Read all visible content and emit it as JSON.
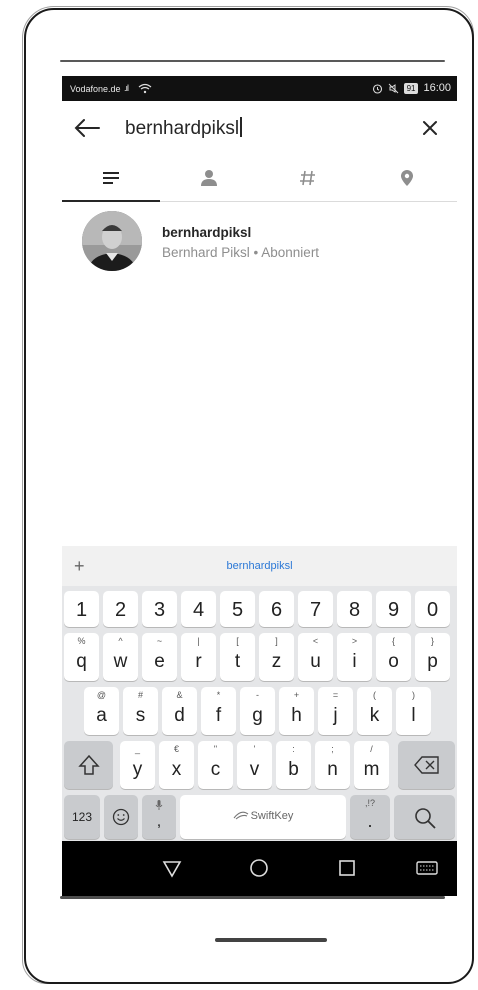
{
  "status_bar": {
    "carrier": "Vodafone.de",
    "signal": ".ıl",
    "battery": "91",
    "time": "16:00"
  },
  "search": {
    "query": "bernhardpiksl"
  },
  "tabs": [
    {
      "name": "top",
      "icon": "lines-icon",
      "active": true
    },
    {
      "name": "people",
      "icon": "person-icon",
      "active": false
    },
    {
      "name": "tags",
      "icon": "hashtag-icon",
      "active": false
    },
    {
      "name": "places",
      "icon": "location-pin-icon",
      "active": false
    }
  ],
  "result": {
    "username": "bernhardpiksl",
    "subtitle": "Bernhard Piksl • Abonniert"
  },
  "keyboard": {
    "suggestion_plus": "+",
    "suggestion": "bernhardpiksl",
    "numbers": [
      "1",
      "2",
      "3",
      "4",
      "5",
      "6",
      "7",
      "8",
      "9",
      "0"
    ],
    "row1": [
      {
        "main": "q",
        "sub": "%"
      },
      {
        "main": "w",
        "sub": "^"
      },
      {
        "main": "e",
        "sub": "~"
      },
      {
        "main": "r",
        "sub": "|"
      },
      {
        "main": "t",
        "sub": "["
      },
      {
        "main": "z",
        "sub": "]"
      },
      {
        "main": "u",
        "sub": "<"
      },
      {
        "main": "i",
        "sub": ">"
      },
      {
        "main": "o",
        "sub": "{"
      },
      {
        "main": "p",
        "sub": "}"
      }
    ],
    "row2": [
      {
        "main": "a",
        "sub": "@"
      },
      {
        "main": "s",
        "sub": "#"
      },
      {
        "main": "d",
        "sub": "&"
      },
      {
        "main": "f",
        "sub": "*"
      },
      {
        "main": "g",
        "sub": "-"
      },
      {
        "main": "h",
        "sub": "+"
      },
      {
        "main": "j",
        "sub": "="
      },
      {
        "main": "k",
        "sub": "("
      },
      {
        "main": "l",
        "sub": ")"
      }
    ],
    "row3": [
      {
        "main": "y",
        "sub": "_"
      },
      {
        "main": "x",
        "sub": "€"
      },
      {
        "main": "c",
        "sub": "\""
      },
      {
        "main": "v",
        "sub": "'"
      },
      {
        "main": "b",
        "sub": ":"
      },
      {
        "main": "n",
        "sub": ";"
      },
      {
        "main": "m",
        "sub": "/"
      }
    ],
    "numbers_key": "123",
    "comma": ",",
    "space_label": "SwiftKey",
    "period": ".",
    "period_sub": ",!?"
  }
}
